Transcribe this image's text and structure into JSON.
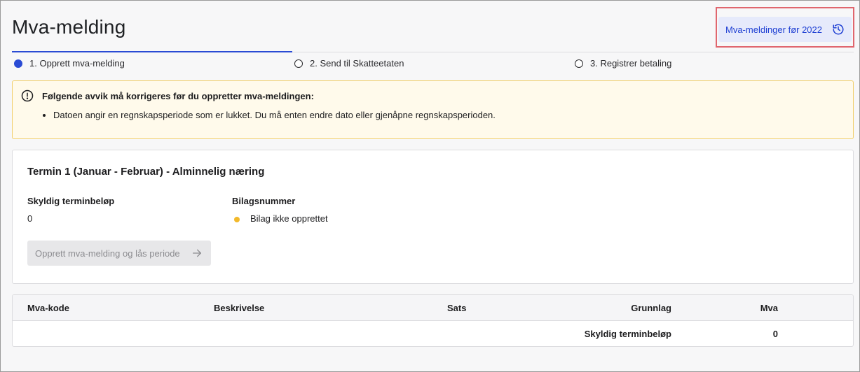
{
  "header": {
    "title": "Mva-melding",
    "history_button_label": "Mva-meldinger før 2022"
  },
  "steps": [
    {
      "label": "1. Opprett mva-melding",
      "active": true
    },
    {
      "label": "2. Send til Skatteetaten",
      "active": false
    },
    {
      "label": "3. Registrer betaling",
      "active": false
    }
  ],
  "alert": {
    "title": "Følgende avvik må korrigeres før du oppretter mva-meldingen:",
    "items": [
      "Datoen angir en regnskapsperiode som er lukket. Du må enten endre dato eller gjenåpne regnskapsperioden."
    ]
  },
  "term_card": {
    "title": "Termin 1 (Januar - Februar) - Alminnelig næring",
    "owed_label": "Skyldig terminbeløp",
    "owed_value": "0",
    "voucher_label": "Bilagsnummer",
    "voucher_status": "Bilag ikke opprettet",
    "create_button_label": "Opprett mva-melding og lås periode"
  },
  "table": {
    "columns": [
      "Mva-kode",
      "Beskrivelse",
      "Sats",
      "Grunnlag",
      "Mva"
    ],
    "summary_label": "Skyldig terminbeløp",
    "summary_value": "0"
  },
  "colors": {
    "accent": "#2a4bd4",
    "warning_border": "#f1cf6b",
    "warning_bg": "#fffaeb",
    "status_dot": "#f2b92b",
    "highlight": "#e0666e"
  }
}
